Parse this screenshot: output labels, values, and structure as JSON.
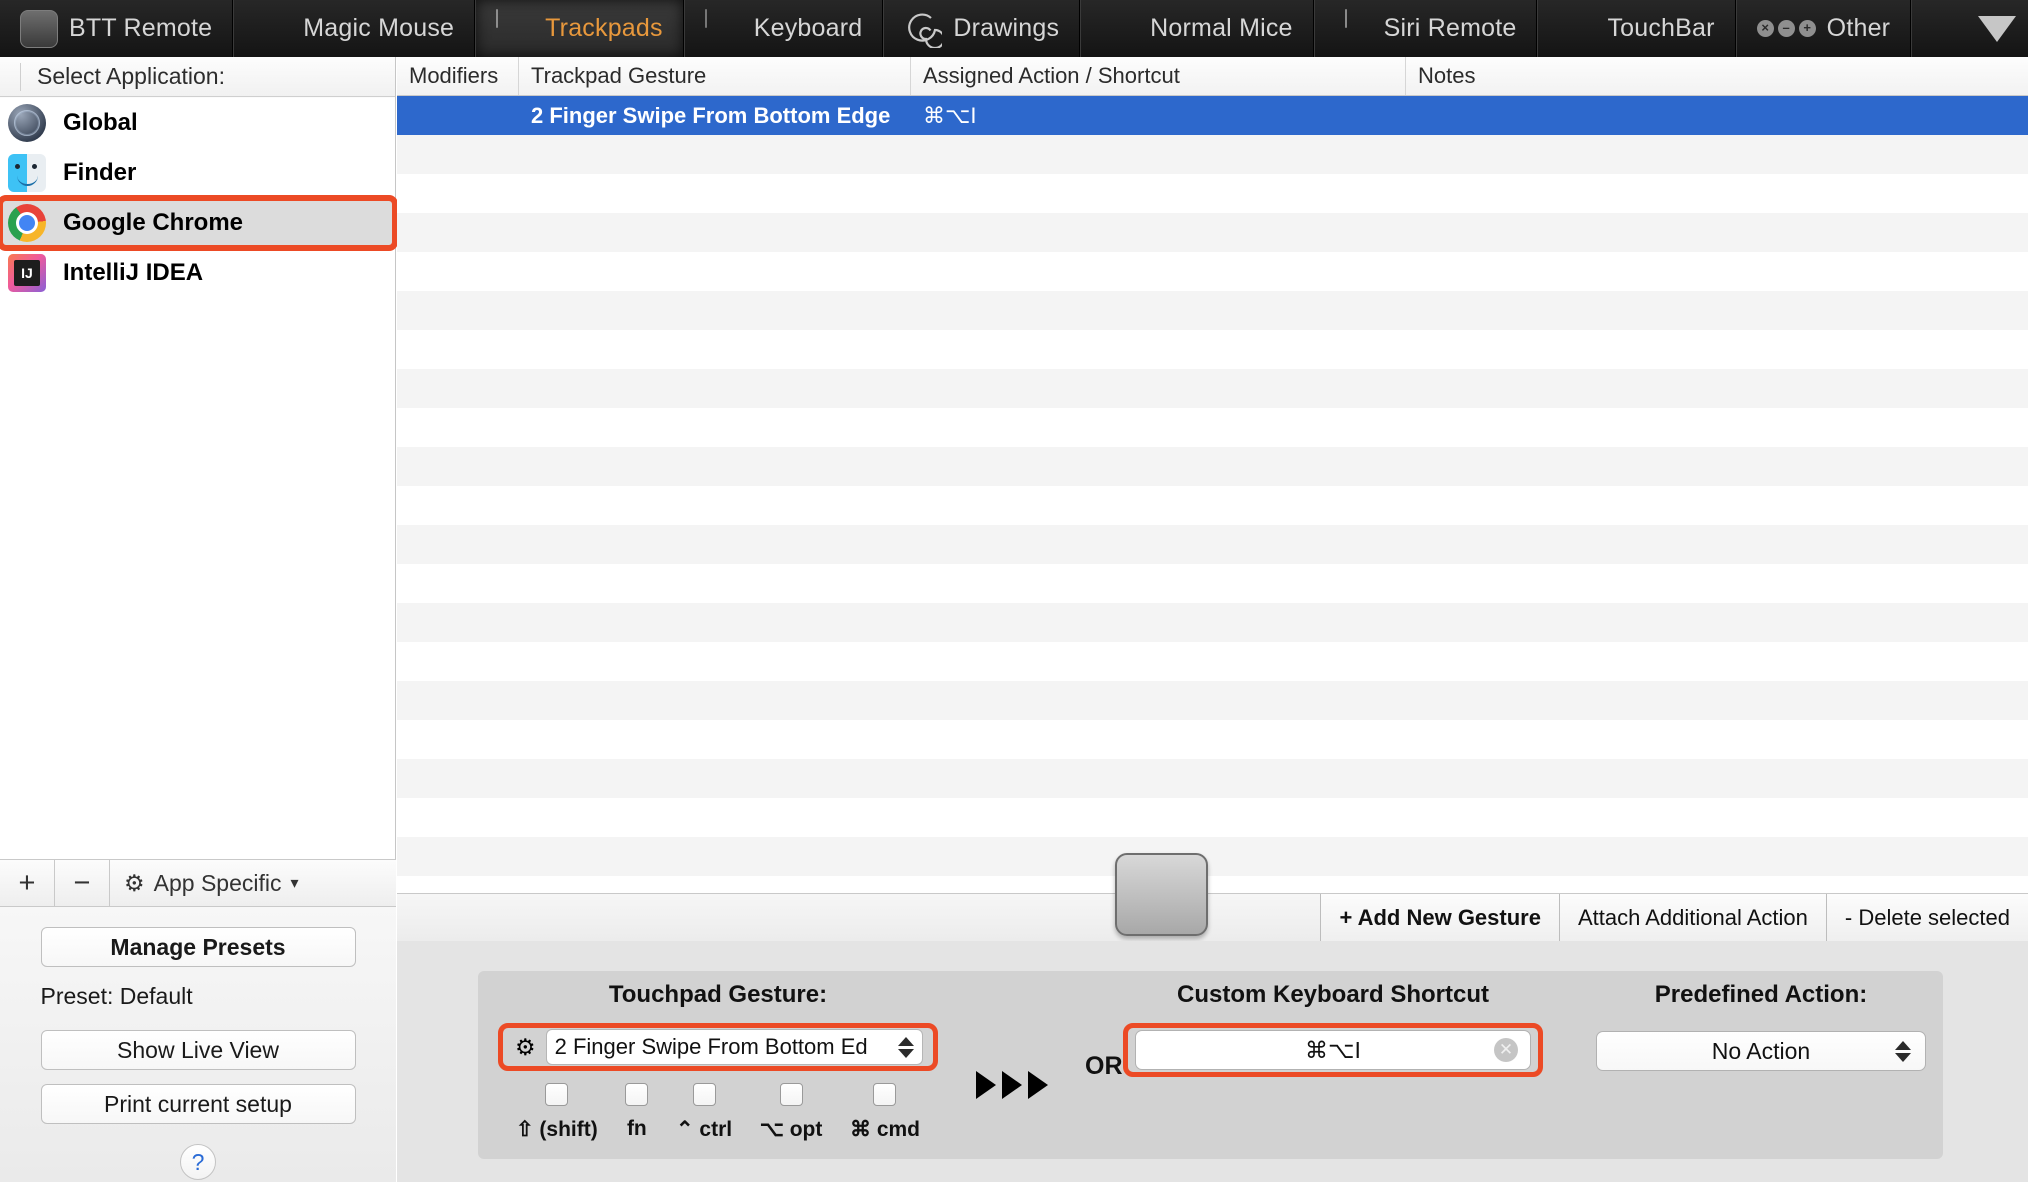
{
  "toolbar": {
    "tabs": [
      {
        "label": "BTT Remote",
        "icon": "btt-remote-icon",
        "active": false
      },
      {
        "label": "Magic Mouse",
        "icon": "magic-mouse-icon",
        "active": false
      },
      {
        "label": "Trackpads",
        "icon": "trackpad-icon",
        "active": true
      },
      {
        "label": "Keyboard",
        "icon": "keyboard-icon",
        "active": false
      },
      {
        "label": "Drawings",
        "icon": "spiral-icon",
        "active": false
      },
      {
        "label": "Normal Mice",
        "icon": "mouse-icon",
        "active": false
      },
      {
        "label": "Siri Remote",
        "icon": "siri-remote-icon",
        "active": false
      },
      {
        "label": "TouchBar",
        "icon": "touchbar-icon",
        "active": false
      },
      {
        "label": "Other",
        "icon": "other-icon",
        "active": false
      }
    ],
    "disclosure_icon": "chevron-down-icon",
    "active_color": "#e8983c"
  },
  "sidebar": {
    "header": "Select Application:",
    "apps": [
      {
        "label": "Global",
        "icon": "globe-icon",
        "selected": false,
        "highlighted": false
      },
      {
        "label": "Finder",
        "icon": "finder-icon",
        "selected": false,
        "highlighted": false
      },
      {
        "label": "Google Chrome",
        "icon": "chrome-icon",
        "selected": true,
        "highlighted": true
      },
      {
        "label": "IntelliJ IDEA",
        "icon": "intellij-icon",
        "selected": false,
        "highlighted": false
      }
    ],
    "bottombar": {
      "add_label": "+",
      "remove_label": "−",
      "app_specific_label": "App Specific",
      "app_specific_caret": "▾",
      "gear_icon": "gear-icon"
    },
    "footer": {
      "manage_presets": "Manage Presets",
      "preset_text": "Preset: Default",
      "show_live_view": "Show Live View",
      "print_current_setup": "Print current setup",
      "help_label": "?"
    }
  },
  "table": {
    "columns": [
      "Modifiers",
      "Trackpad Gesture",
      "Assigned Action / Shortcut",
      "Notes"
    ],
    "selected_row": {
      "modifiers": "",
      "gesture": "2 Finger Swipe From Bottom Edge",
      "action": "⌘⌥I",
      "notes": ""
    },
    "selection_color": "#2d68cc",
    "empty_row_count": 19
  },
  "action_bar": {
    "buttons": [
      {
        "label": "+ Add New Gesture",
        "bold": true
      },
      {
        "label": "Attach Additional Action",
        "bold": false
      },
      {
        "label": "- Delete selected",
        "bold": false
      }
    ],
    "trackpad_preview_icon": "trackpad-preview-icon"
  },
  "config": {
    "gesture": {
      "title": "Touchpad Gesture:",
      "gear_icon": "gear-icon",
      "selected": "2 Finger Swipe From Bottom Ed",
      "stepper_icon": "stepper-updown-icon",
      "highlight_color": "#ec4a25"
    },
    "modifiers": [
      {
        "label": "⇧ (shift)",
        "checked": false
      },
      {
        "label": "fn",
        "checked": false
      },
      {
        "label": "⌃ ctrl",
        "checked": false
      },
      {
        "label": "⌥ opt",
        "checked": false
      },
      {
        "label": "⌘ cmd",
        "checked": false
      }
    ],
    "flow_arrows_icon": "triple-right-arrow-icon",
    "shortcut": {
      "title": "Custom Keyboard Shortcut",
      "value": "⌘⌥I",
      "clear_icon": "clear-circle-icon",
      "clear_glyph": "✕",
      "highlight_color": "#ec4a25"
    },
    "or_label": "OR",
    "predefined": {
      "title": "Predefined Action:",
      "selected": "No Action",
      "stepper_icon": "stepper-updown-icon"
    }
  }
}
